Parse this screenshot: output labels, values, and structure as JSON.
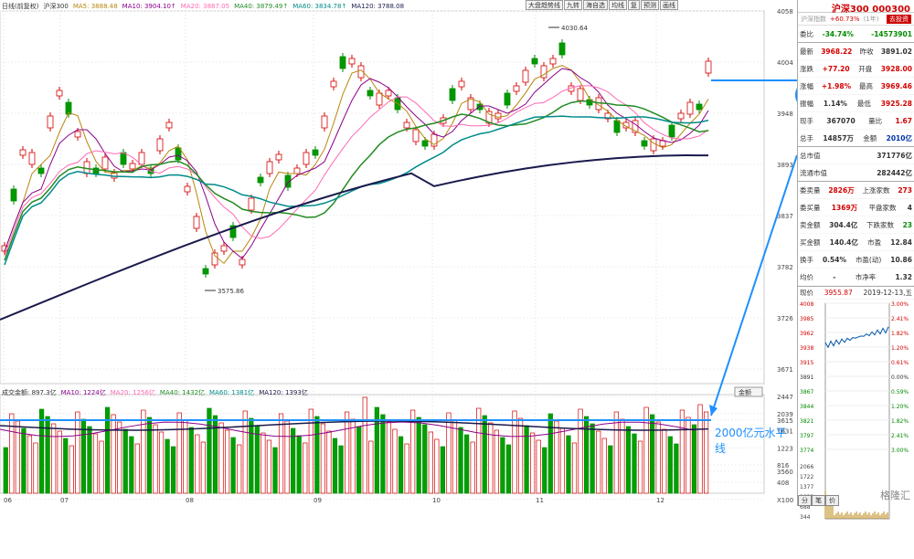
{
  "toolbar": [
    "大盘趋势线",
    "九转",
    "海自选",
    "均线",
    "复",
    "预测",
    "画线"
  ],
  "kline_legend": [
    {
      "t": "日线(前复权)",
      "c": "#333333"
    },
    {
      "t": "沪深300",
      "c": "#333333"
    },
    {
      "t": "MA5: 3888.48",
      "c": "#b8860b"
    },
    {
      "t": "MA10: 3904.10↑",
      "c": "#8b008b"
    },
    {
      "t": "MA20: 3887.05",
      "c": "#ff69b4"
    },
    {
      "t": "MA40: 3879.49↑",
      "c": "#228b22"
    },
    {
      "t": "MA60: 3834.78↑",
      "c": "#008b8b"
    },
    {
      "t": "MA120: 3788.08",
      "c": "#1a1a4d"
    }
  ],
  "vol_legend": [
    {
      "t": "成交金额: 897.3亿",
      "c": "#333333"
    },
    {
      "t": "MA10: 1224亿",
      "c": "#8b008b"
    },
    {
      "t": "MA20: 1256亿",
      "c": "#ff69b4"
    },
    {
      "t": "MA40: 1432亿",
      "c": "#228b22"
    },
    {
      "t": "MA60: 1381亿",
      "c": "#008b8b"
    },
    {
      "t": "MA120: 1393亿",
      "c": "#1a1a4d"
    }
  ],
  "price_axis": [
    "4058",
    "4004",
    "3948",
    "3893",
    "3837",
    "3782",
    "3726",
    "3671",
    "3615",
    "3560"
  ],
  "vol_axis": [
    "2447",
    "2039",
    "1631",
    "1223",
    "816",
    "408",
    "X100"
  ],
  "month_labels": [
    "06",
    "07",
    "08",
    "09",
    "10",
    "11",
    "12"
  ],
  "high_label": "4030.64",
  "low_label": "3575.86",
  "vol_dropdown": "金额",
  "annotation": "2000亿元水平线",
  "panel": {
    "name": "沪深300 000300",
    "sub_left": "沪深指数",
    "sub_mid": "+60.73%",
    "sub_note": "(1年)",
    "sub_btn": "去投资",
    "rows": [
      {
        "a": "委比",
        "av": "-34.74%",
        "ac": "green",
        "b": "",
        "bv": "-14573901",
        "bc": "green"
      },
      {
        "a": "最新",
        "av": "3968.22",
        "ac": "red",
        "b": "昨收",
        "bv": "3891.02",
        "bc": ""
      },
      {
        "a": "涨跌",
        "av": "+77.20",
        "ac": "red",
        "b": "开盘",
        "bv": "3928.00",
        "bc": "red"
      },
      {
        "a": "涨幅",
        "av": "+1.98%",
        "ac": "red",
        "b": "最高",
        "bv": "3969.46",
        "bc": "red"
      },
      {
        "a": "振幅",
        "av": "1.14%",
        "ac": "",
        "b": "最低",
        "bv": "3925.28",
        "bc": "red"
      },
      {
        "a": "现手",
        "av": "367070",
        "ac": "",
        "b": "量比",
        "bv": "1.67",
        "bc": "red"
      },
      {
        "a": "总手",
        "av": "14857万",
        "ac": "",
        "b": "金额",
        "bv": "2010亿",
        "bc": "blue"
      },
      {
        "a": "总市值",
        "av": "",
        "ac": "",
        "b": "",
        "bv": "371776亿",
        "bc": ""
      },
      {
        "a": "流通市值",
        "av": "",
        "ac": "",
        "b": "",
        "bv": "282442亿",
        "bc": ""
      },
      {
        "a": "委卖量",
        "av": "2826万",
        "ac": "red",
        "b": "上涨家数",
        "bv": "273",
        "bc": "red"
      },
      {
        "a": "委买量",
        "av": "1369万",
        "ac": "red",
        "b": "平盘家数",
        "bv": "4",
        "bc": ""
      },
      {
        "a": "卖金额",
        "av": "304.4亿",
        "ac": "",
        "b": "下跌家数",
        "bv": "23",
        "bc": "green"
      },
      {
        "a": "买金额",
        "av": "140.4亿",
        "ac": "",
        "b": "市盈",
        "bv": "12.84",
        "bc": ""
      },
      {
        "a": "换手",
        "av": "0.54%",
        "ac": "",
        "b": "市盈(动)",
        "bv": "10.86",
        "bc": ""
      },
      {
        "a": "均价",
        "av": "-",
        "ac": "",
        "b": "市净率",
        "bv": "1.32",
        "bc": ""
      }
    ],
    "now_label": "现价",
    "now_value": "3955.87",
    "date": "2019-12-13,五",
    "intraday_left": [
      "4008",
      "3985",
      "3962",
      "3938",
      "3915",
      "3891",
      "3867",
      "3844",
      "3821",
      "3797",
      "3774"
    ],
    "intraday_right": [
      "3.00%",
      "2.41%",
      "1.82%",
      "1.20%",
      "0.61%",
      "0.00%",
      "0.59%",
      "1.20%",
      "1.82%",
      "2.41%",
      "3.00%"
    ],
    "vol_left": [
      "2066",
      "1722",
      "1377",
      "1033",
      "688",
      "344"
    ],
    "tabs": [
      "分",
      "笔",
      "价"
    ],
    "watermark": "格隆汇"
  }
}
